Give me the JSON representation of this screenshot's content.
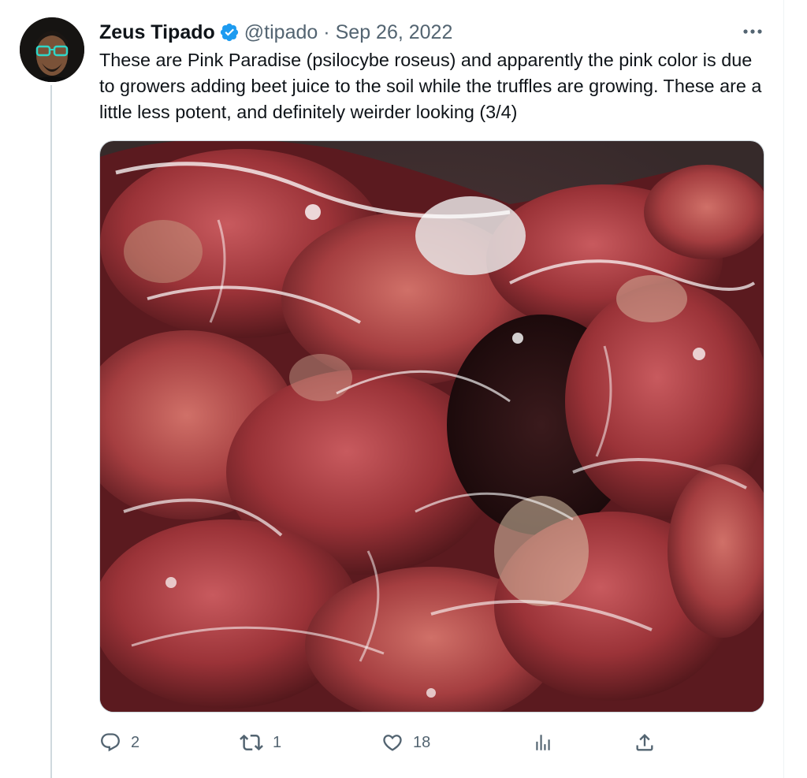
{
  "tweet": {
    "author": {
      "display_name": "Zeus Tipado",
      "handle": "@tipado",
      "verified_icon": "verified-badge-icon",
      "avatar": "avatar-image"
    },
    "date": "Sep 26, 2022",
    "separator": "·",
    "text": "These are Pink Paradise (psilocybe roseus) and apparently the pink color is due to growers adding beet juice to the soil while the truffles are growing. These are a little less potent, and definitely weirder looking (3/4)",
    "media": {
      "type": "photo",
      "subject": "pink-truffles-in-vacuum-bag"
    },
    "actions": {
      "reply": {
        "icon": "reply-icon",
        "count": "2"
      },
      "retweet": {
        "icon": "retweet-icon",
        "count": "1"
      },
      "like": {
        "icon": "heart-icon",
        "count": "18"
      },
      "views": {
        "icon": "analytics-icon"
      },
      "share": {
        "icon": "share-icon"
      }
    }
  },
  "colors": {
    "text_primary": "#0f1419",
    "text_secondary": "#536471",
    "verified": "#1d9bf0",
    "thread_line": "#cfd9de"
  }
}
